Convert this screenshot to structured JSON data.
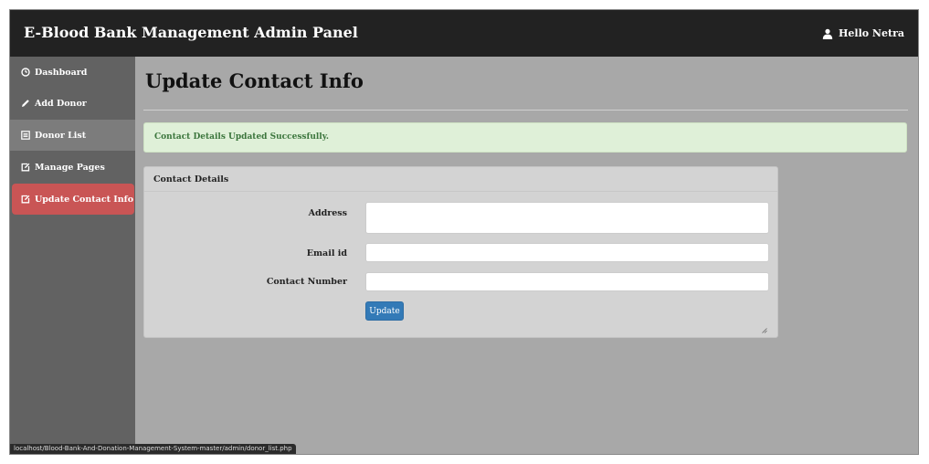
{
  "header": {
    "title": "E-Blood Bank Management Admin Panel",
    "user_greeting": "Hello Netra"
  },
  "sidebar": {
    "items": [
      {
        "label": "Dashboard",
        "icon": "dashboard-icon"
      },
      {
        "label": "Add Donor",
        "icon": "pencil-icon"
      },
      {
        "label": "Donor List",
        "icon": "list-icon"
      },
      {
        "label": "Manage Pages",
        "icon": "edit-icon"
      },
      {
        "label": "Update Contact Info",
        "icon": "edit-icon",
        "active": true
      }
    ]
  },
  "main": {
    "page_title": "Update Contact Info",
    "alert": "Contact Details Updated Successfully.",
    "panel": {
      "heading": "Contact Details",
      "fields": {
        "address": {
          "label": "Address",
          "value": ""
        },
        "email": {
          "label": "Email id",
          "value": ""
        },
        "contact": {
          "label": "Contact Number",
          "value": ""
        }
      },
      "submit_label": "Update"
    }
  },
  "statusbar": {
    "url": "localhost/Blood-Bank-And-Donation-Management-System-master/admin/donor_list.php"
  },
  "colors": {
    "topbar": "#222222",
    "sidebar": "#626262",
    "active_item": "#c95555",
    "content_bg": "#a8a8a8",
    "alert_bg": "#dff0d8",
    "alert_text": "#3c763d",
    "button": "#337ab7"
  }
}
